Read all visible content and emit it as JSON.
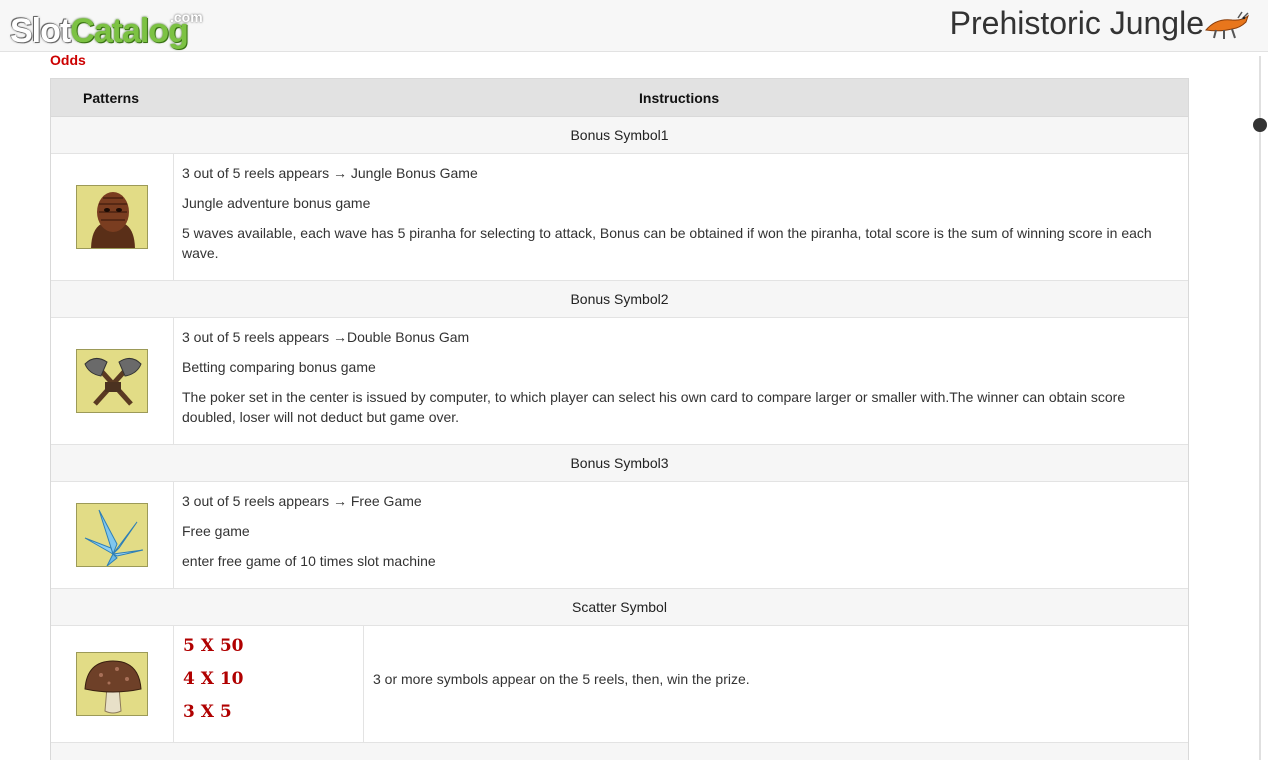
{
  "header": {
    "logo_script": "SlotCatalog",
    "logo_slot": "Slot",
    "logo_catalog": "Catalog",
    "logo_com": ".com",
    "game_title": "Prehistoric Jungle"
  },
  "section_label": "Odds",
  "table": {
    "col_patterns": "Patterns",
    "col_instructions": "Instructions",
    "bonus1": {
      "title": "Bonus Symbol1",
      "icon": "tribal-mask-icon",
      "line1": "3 out of 5 reels appears → Jungle Bonus Game",
      "line2": "Jungle adventure bonus game",
      "line3": "5 waves available, each wave has 5 piranha for selecting to attack, Bonus can be obtained if won the piranha, total score is the sum of winning score in each wave."
    },
    "bonus2": {
      "title": "Bonus Symbol2",
      "icon": "crossed-axes-icon",
      "line1": "3 out of 5 reels appears →Double Bonus Gam",
      "line2": "Betting comparing bonus game",
      "line3": "The poker set in the center is issued by computer, to which player can select his own card to compare larger or smaller with.The winner can obtain score doubled, loser will not deduct but game over."
    },
    "bonus3": {
      "title": "Bonus Symbol3",
      "icon": "ice-crystal-icon",
      "line1": "3 out of 5 reels appears → Free Game",
      "line2": "Free game",
      "line3": "enter free game of 10 times slot machine"
    },
    "scatter": {
      "title": "Scatter Symbol",
      "icon": "mushroom-icon",
      "pay1": "5 X 50",
      "pay2": "4 X 10",
      "pay3": "3 X 5",
      "description": "3 or more symbols appear on the 5 reels, then, win the prize."
    }
  },
  "colors": {
    "accent_red": "#cc0000",
    "payout_red": "#b00000",
    "logo_green": "#7cc243",
    "header_bg": "#e2e2e2"
  }
}
